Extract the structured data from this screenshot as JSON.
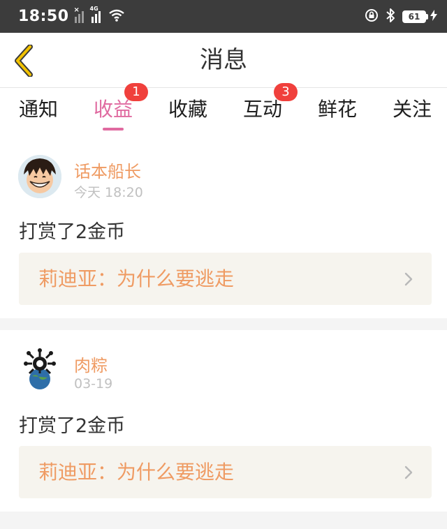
{
  "status_bar": {
    "time": "18:50",
    "signal1_mark": "×",
    "signal2_label": "4G",
    "battery": "61",
    "icons": [
      "signal-icon",
      "signal-4g-icon",
      "wifi-icon",
      "lock-rotation-icon",
      "bluetooth-icon",
      "battery-icon",
      "charging-icon"
    ]
  },
  "header": {
    "title": "消息",
    "back_icon": "chevron-left-icon"
  },
  "tabs": [
    {
      "label": "通知",
      "badge": null,
      "active": false
    },
    {
      "label": "收益",
      "badge": "1",
      "active": true
    },
    {
      "label": "收藏",
      "badge": null,
      "active": false
    },
    {
      "label": "互动",
      "badge": "3",
      "active": false
    },
    {
      "label": "鲜花",
      "badge": null,
      "active": false
    },
    {
      "label": "关注",
      "badge": null,
      "active": false
    }
  ],
  "messages": [
    {
      "username": "话本船长",
      "time": "今天 18:20",
      "action": "打赏了2金币",
      "book": "莉迪亚：为什么要逃走"
    },
    {
      "username": "肉粽",
      "time": "03-19",
      "action": "打赏了2金币",
      "book": "莉迪亚：为什么要逃走"
    }
  ],
  "colors": {
    "accent_pink": "#e06aa0",
    "badge_red": "#f0403c",
    "name_orange": "#ef9b63",
    "back_yellow": "#f2c200",
    "link_bg": "#f6f4ee"
  }
}
